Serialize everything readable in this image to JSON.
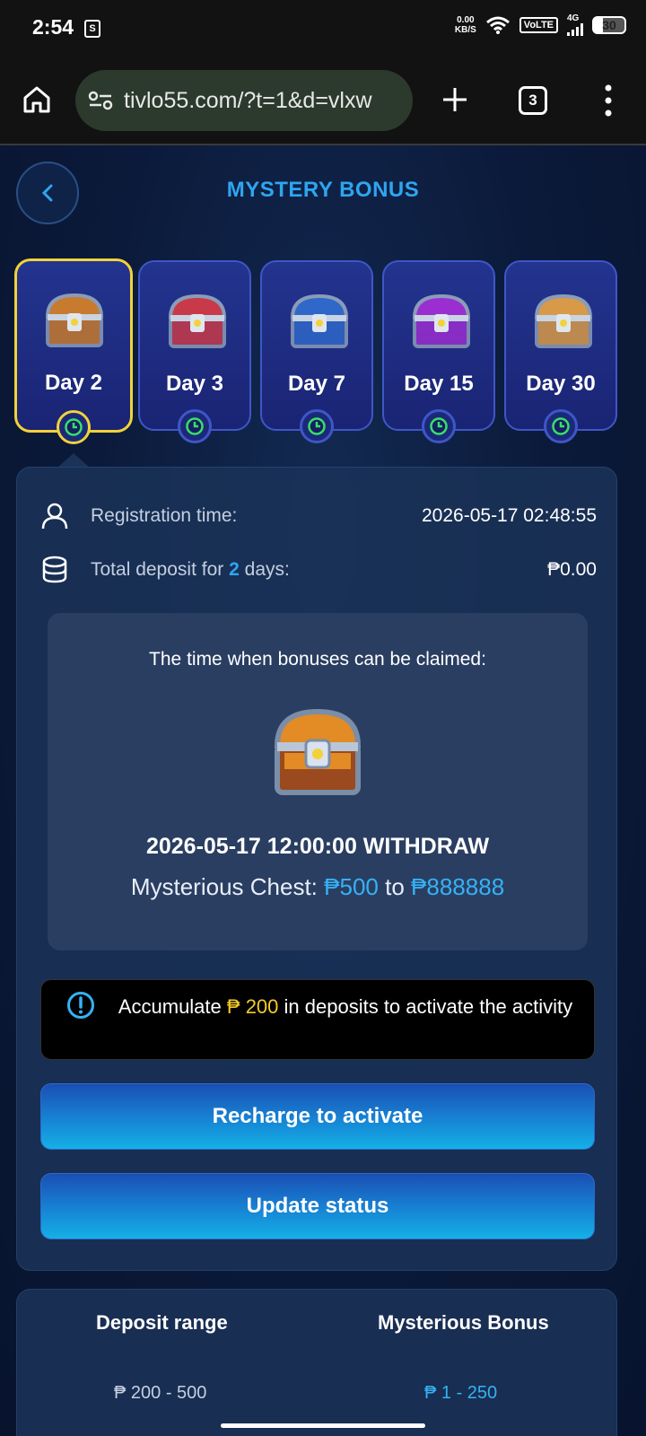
{
  "status_bar": {
    "time": "2:54",
    "net_speed_value": "0.00",
    "net_speed_unit": "KB/S",
    "volte": "VoLTE",
    "network": "4G",
    "battery": "30"
  },
  "browser": {
    "url": "tivlo55.com/?t=1&d=vlxw",
    "tab_count": "3"
  },
  "header": {
    "title": "MYSTERY BONUS"
  },
  "days": [
    {
      "label": "Day",
      "num": "2",
      "active": true,
      "chest_color": "#c87a2e"
    },
    {
      "label": "Day",
      "num": "3",
      "active": false,
      "chest_color": "#c83a4a"
    },
    {
      "label": "Day",
      "num": "7",
      "active": false,
      "chest_color": "#2f68c8"
    },
    {
      "label": "Day",
      "num": "15",
      "active": false,
      "chest_color": "#9a2ed0"
    },
    {
      "label": "Day",
      "num": "30",
      "active": false,
      "chest_color": "#d89a48"
    }
  ],
  "info": {
    "registration_label": "Registration time:",
    "registration_value": "2026-05-17 02:48:55",
    "deposit_label_pre": "Total deposit for",
    "deposit_days": "2",
    "deposit_label_post": "days:",
    "deposit_value": "₱0.00"
  },
  "claim": {
    "heading": "The time when bonuses can be claimed:",
    "datetime": "2026-05-17 12:00:00 WITHDRAW",
    "chest_prefix": "Mysterious Chest:",
    "min": "₱500",
    "to": "to",
    "max": "₱888888"
  },
  "notice": {
    "pre": "Accumulate",
    "amount": "₱ 200",
    "post": "in deposits to activate the activity"
  },
  "buttons": {
    "recharge": "Recharge to activate",
    "update": "Update status"
  },
  "table": {
    "col1": "Deposit range",
    "col2": "Mysterious Bonus",
    "rows": [
      {
        "range": "₱ 200 - 500",
        "bonus": "₱ 1 - 250"
      }
    ]
  }
}
